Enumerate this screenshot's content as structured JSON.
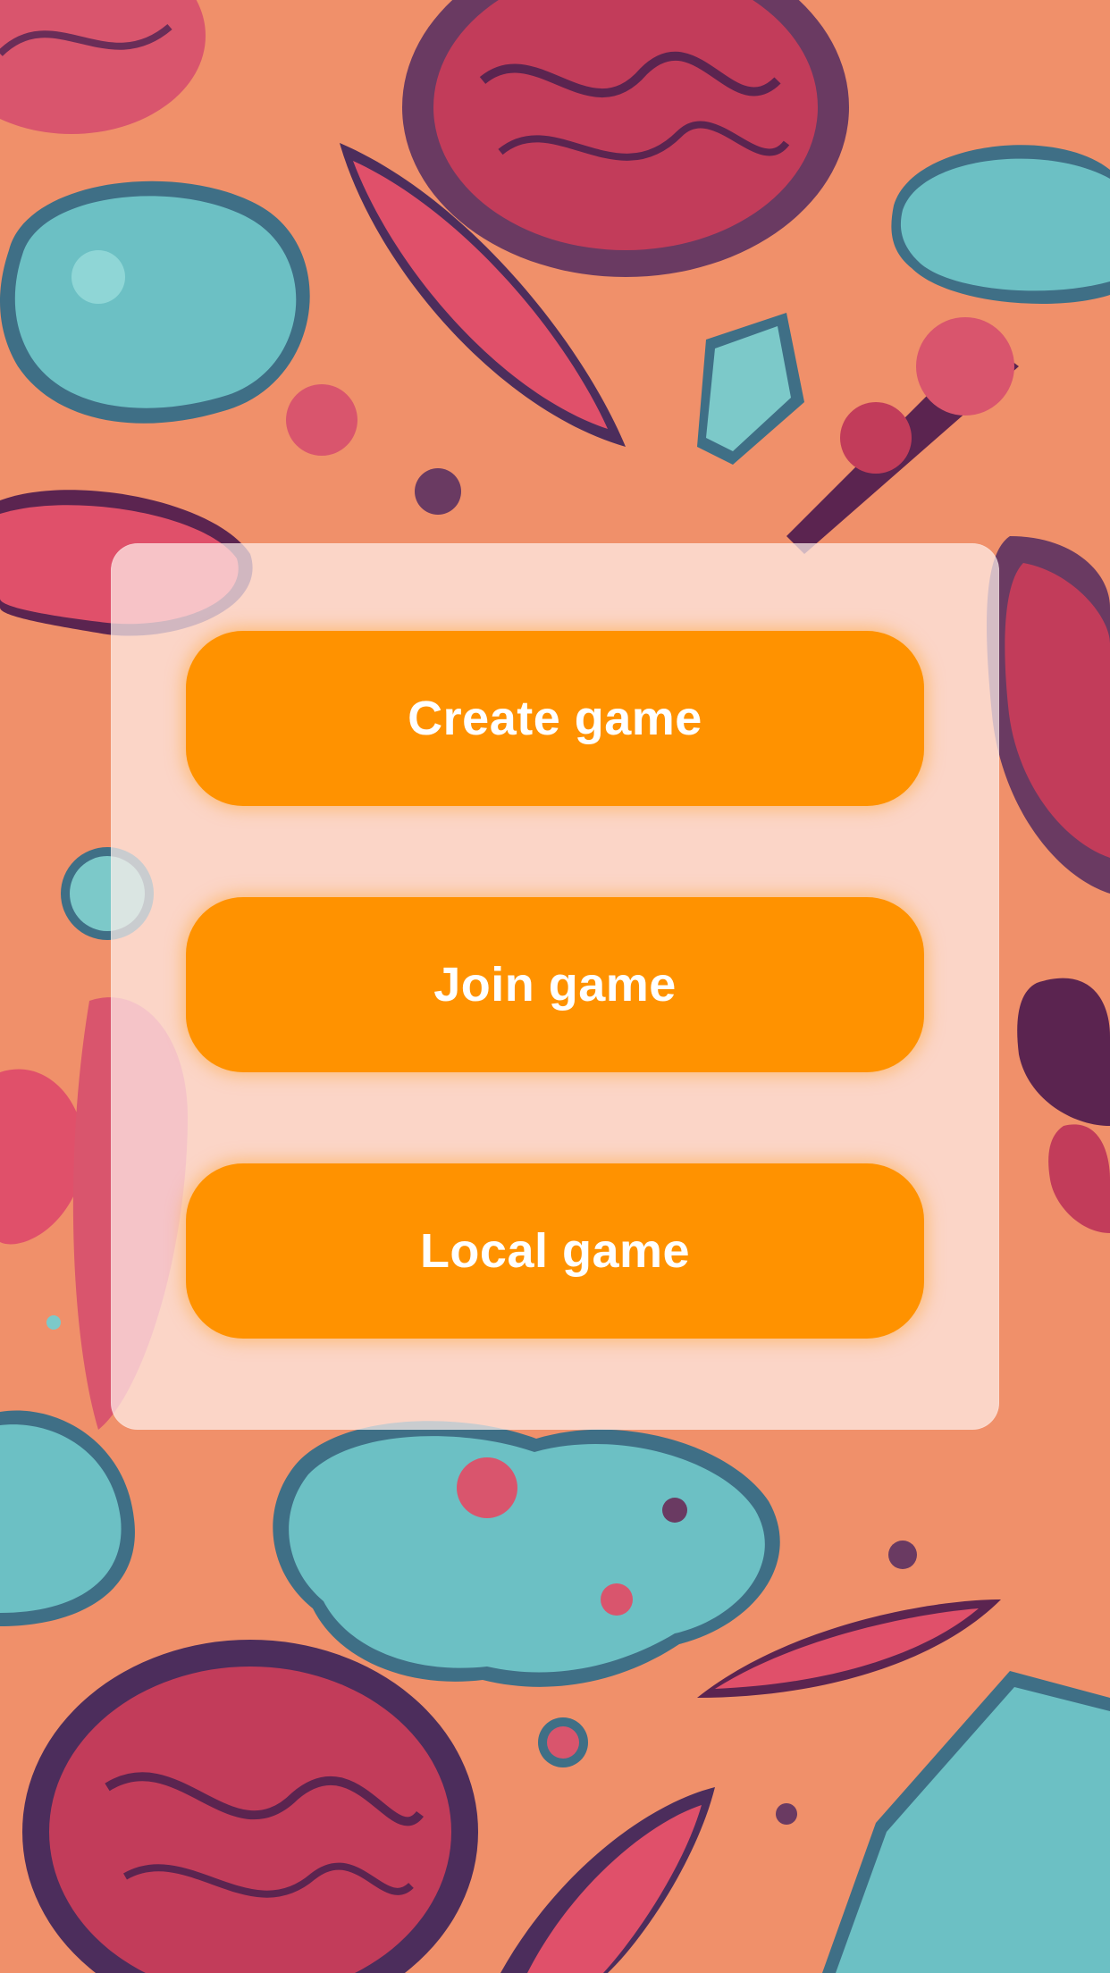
{
  "theme": {
    "background": "#f0906a",
    "accent": "#ff9200",
    "button_text": "#ffffff",
    "panel": "rgba(255,240,236,0.72)"
  },
  "background_art": {
    "description_icon": "abstract-cells-pattern"
  },
  "menu": {
    "buttons": [
      {
        "label": "Create game",
        "icon": "none"
      },
      {
        "label": "Join game",
        "icon": "none"
      },
      {
        "label": "Local game",
        "icon": "none"
      }
    ]
  }
}
